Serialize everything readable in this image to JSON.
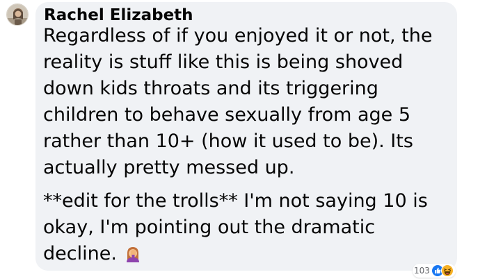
{
  "comment": {
    "author": "Rachel Elizabeth",
    "paragraph_1": [
      "Regardless of if you enjoyed it or not, the",
      "reality is stuff like this is being shoved",
      "down kids throats and its triggering",
      "children to behave sexually from age 5",
      "rather than 10+ (how it used to be). Its",
      "actually pretty messed up."
    ],
    "paragraph_2": [
      "**edit for the trolls** I'm not saying 10 is",
      "okay, I'm pointing out the dramatic",
      "decline."
    ],
    "inline_emoji": "woman-facepalming-icon"
  },
  "reactions": {
    "count": "103",
    "icons": [
      "like-icon",
      "haha-icon"
    ],
    "colors": {
      "like": "#1877f2",
      "haha": "#f7b125"
    }
  },
  "colors": {
    "bubble_background": "#f0f2f5",
    "text": "#050505",
    "meta_text": "#65676b"
  }
}
